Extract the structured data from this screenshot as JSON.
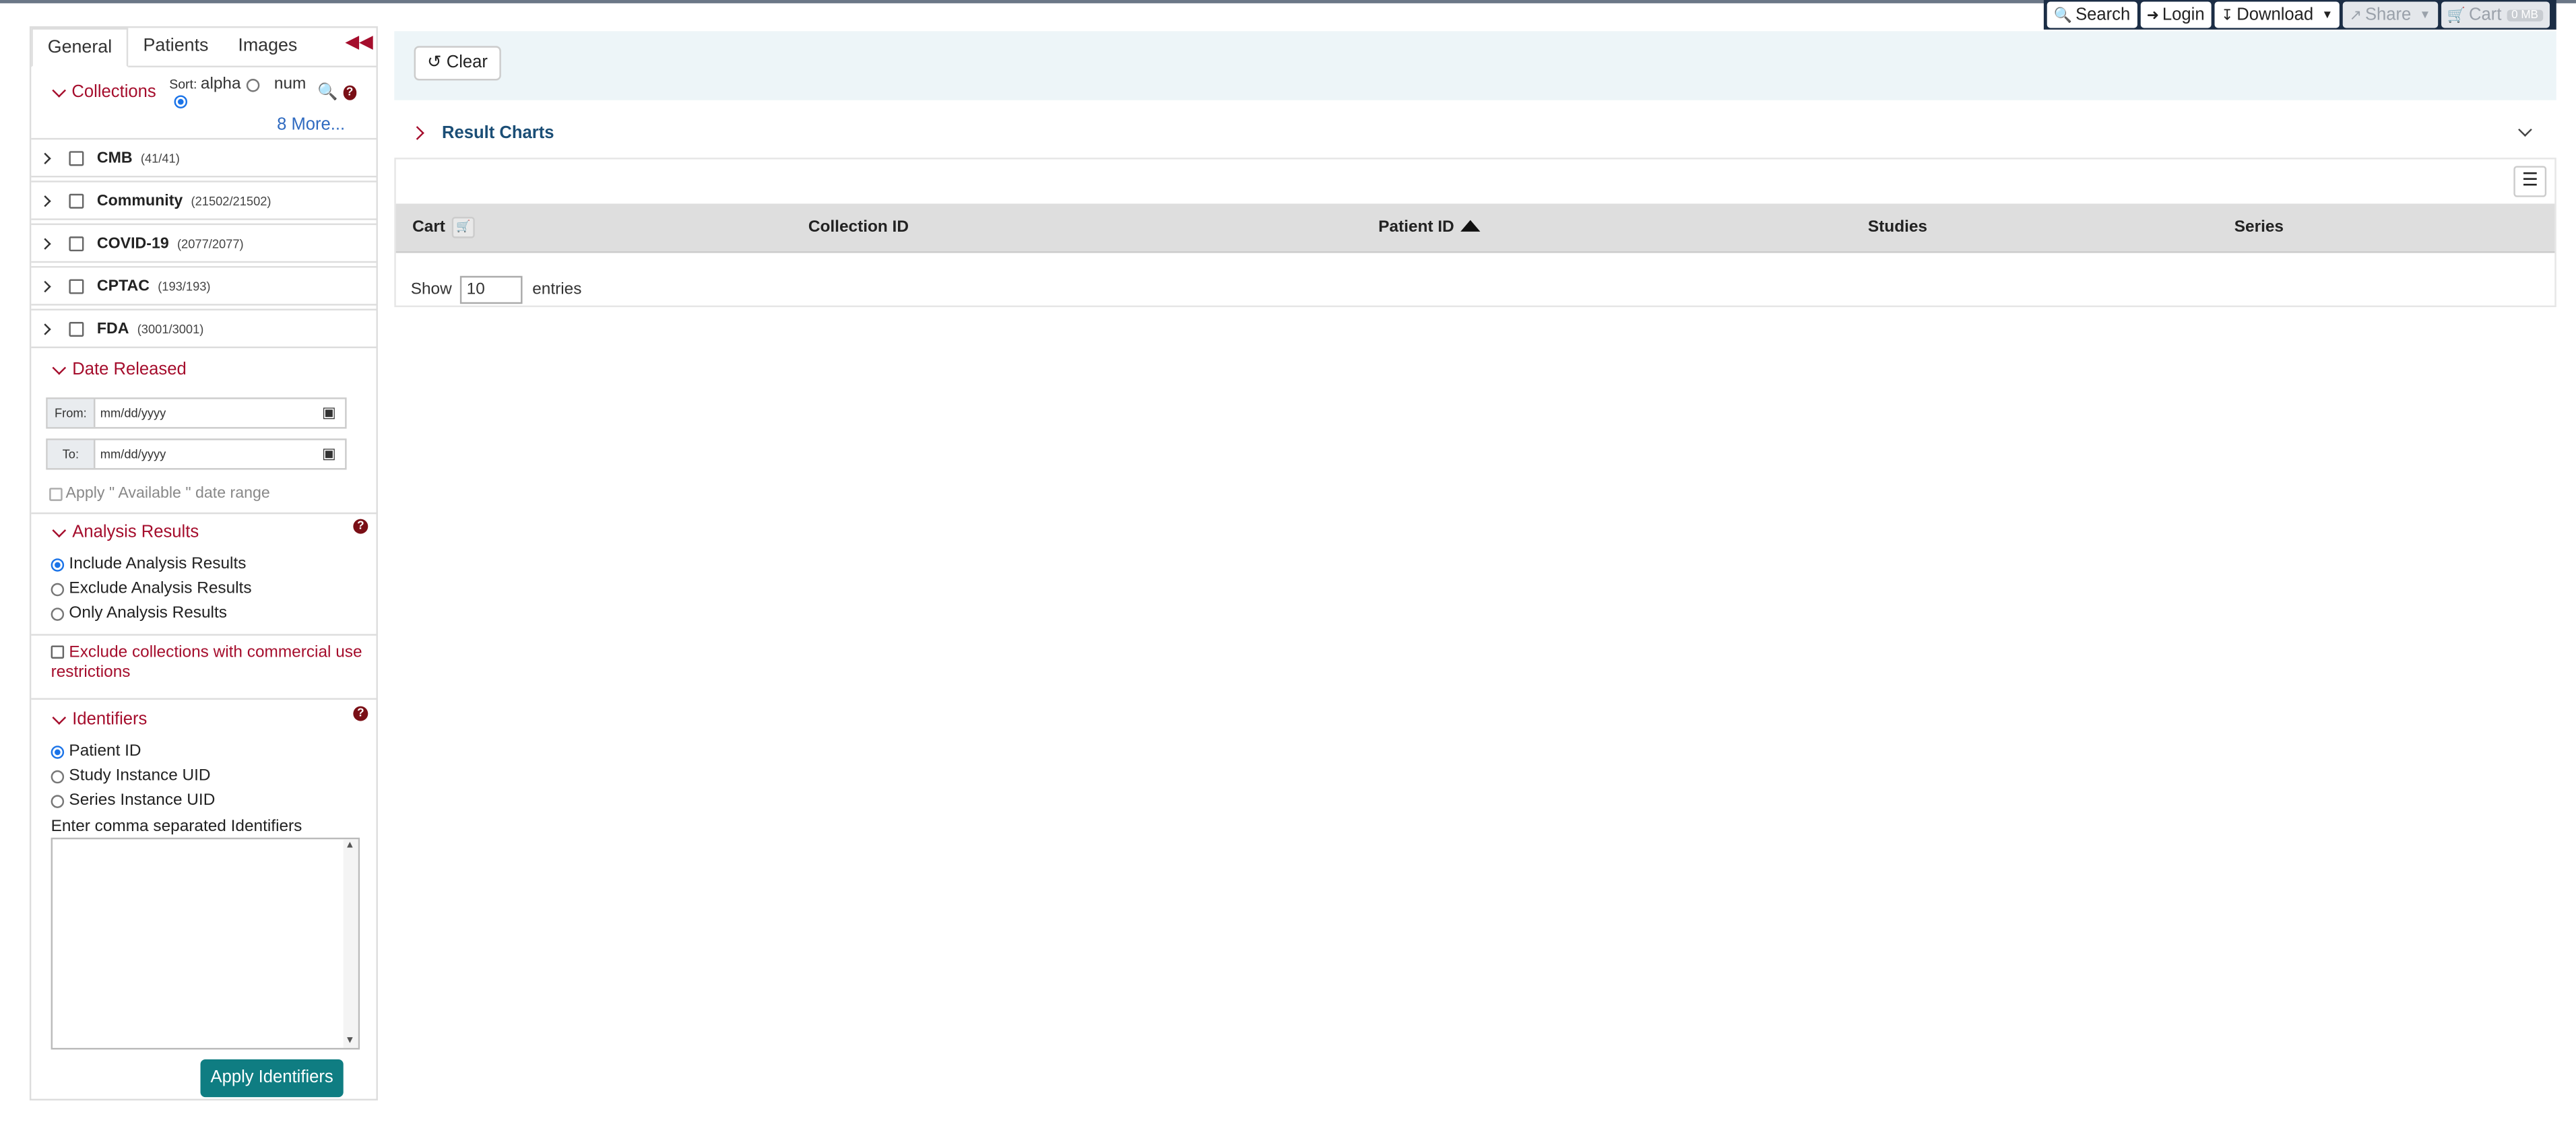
{
  "nav": {
    "search": "Search",
    "login": "Login",
    "download": "Download",
    "share": "Share",
    "cart": "Cart",
    "cart_count": "0 MB"
  },
  "sidebar": {
    "tabs": [
      {
        "label": "General"
      },
      {
        "label": "Patients"
      },
      {
        "label": "Images"
      }
    ],
    "collections": {
      "title": "Collections",
      "sort_label": "Sort:",
      "sort_alpha": "alpha",
      "sort_num": "num",
      "more": "8 More...",
      "items": [
        {
          "name": "CMB",
          "count": "(41/41)"
        },
        {
          "name": "Community",
          "count": "(21502/21502)"
        },
        {
          "name": "COVID-19",
          "count": "(2077/2077)"
        },
        {
          "name": "CPTAC",
          "count": "(193/193)"
        },
        {
          "name": "FDA",
          "count": "(3001/3001)"
        }
      ]
    },
    "date": {
      "title": "Date Released",
      "from_label": "From:",
      "to_label": "To:",
      "placeholder": "mm/dd/yyyy",
      "apply_label": "Apply \" Available \" date range"
    },
    "analysis": {
      "title": "Analysis Results",
      "options": [
        {
          "label": "Include Analysis Results",
          "checked": true
        },
        {
          "label": "Exclude Analysis Results",
          "checked": false
        },
        {
          "label": "Only Analysis Results",
          "checked": false
        }
      ]
    },
    "commercial": {
      "label": "Exclude collections with commercial use restrictions"
    },
    "identifiers": {
      "title": "Identifiers",
      "options": [
        {
          "label": "Patient ID",
          "checked": true
        },
        {
          "label": "Study Instance UID",
          "checked": false
        },
        {
          "label": "Series Instance UID",
          "checked": false
        }
      ],
      "prompt": "Enter comma separated Identifiers",
      "apply": "Apply Identifiers"
    }
  },
  "main": {
    "clear": "Clear",
    "charts_label": "Result Charts",
    "columns": [
      "Cart",
      "Collection ID",
      "Patient ID",
      "Studies",
      "Series"
    ],
    "show_label": "Show",
    "show_value": "10",
    "entries_label": "entries"
  },
  "colors": {
    "accent": "#a50d2c",
    "teal": "#0f7d82",
    "navy": "#1b2d45"
  }
}
